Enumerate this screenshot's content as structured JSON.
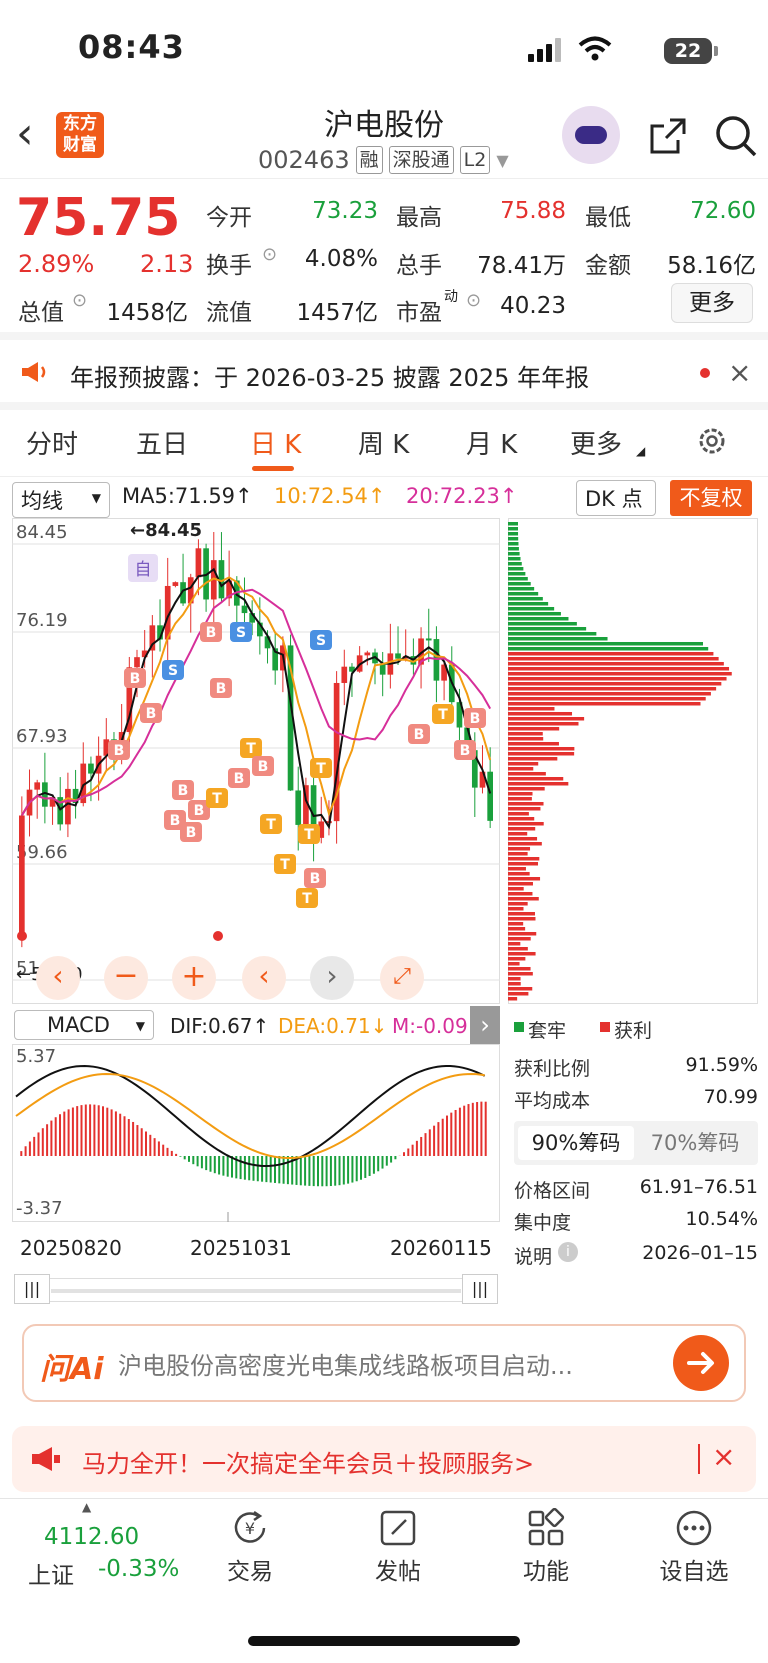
{
  "status": {
    "time": "08:43",
    "battery": "22"
  },
  "header": {
    "title": "沪电股份",
    "code": "002463",
    "tags": [
      "融",
      "深股通",
      "L2"
    ],
    "logo": "东方\n财富"
  },
  "quote": {
    "price": "75.75",
    "pct": "2.89%",
    "chg": "2.13",
    "rows": [
      [
        {
          "label": "今开",
          "value": "73.23",
          "color": "green"
        },
        {
          "label": "最高",
          "value": "75.88",
          "color": "red"
        },
        {
          "label": "最低",
          "value": "72.60",
          "color": "green"
        }
      ],
      [
        {
          "label": "换手",
          "value": "4.08%",
          "color": ""
        },
        {
          "label": "总手",
          "value": "78.41万",
          "color": ""
        },
        {
          "label": "金额",
          "value": "58.16亿",
          "color": ""
        }
      ],
      [
        {
          "label": "总值",
          "value": "1458亿",
          "color": ""
        },
        {
          "label": "流值",
          "value": "1457亿",
          "color": ""
        },
        {
          "label": "市盈",
          "value": "40.23",
          "color": ""
        }
      ]
    ],
    "pe_sup": "动",
    "more": "更多"
  },
  "notice": {
    "text": "年报预披露：于 2026-03-25 披露 2025 年年报"
  },
  "tabs": [
    "分时",
    "五日",
    "日 K",
    "周 K",
    "月 K",
    "更多"
  ],
  "ma": {
    "select": "均线",
    "ma5": "MA5:71.59↑",
    "ma10": "10:72.54↑",
    "ma20": "20:72.23↑",
    "dk": "DK 点",
    "fq": "不复权"
  },
  "kchart": {
    "y_ticks": [
      "84.45",
      "76.19",
      "67.93",
      "59.66",
      "51.40"
    ],
    "max_label": "←84.45",
    "min_label": "←51.40",
    "self_tag": "自"
  },
  "macd": {
    "select": "MACD",
    "dif": "DIF:0.67↑",
    "dea": "DEA:0.71↓",
    "m": "M:-0.09",
    "top": "5.37",
    "bottom": "-3.37",
    "dates": [
      "20250820",
      "20251031",
      "20260115"
    ]
  },
  "chip": {
    "legend_a": "套牢",
    "legend_b": "获利",
    "profit_ratio_label": "获利比例",
    "profit_ratio": "91.59%",
    "avg_cost_label": "平均成本",
    "avg_cost": "70.99",
    "tab90": "90%筹码",
    "tab70": "70%筹码",
    "range_label": "价格区间",
    "range": "61.91–76.51",
    "conc_label": "集中度",
    "conc": "10.54%",
    "note_label": "说明",
    "note": "2026–01–15"
  },
  "ai": {
    "logo": "问Ai",
    "text": "沪电股份高密度光电集成线路板项目启动..."
  },
  "promo": {
    "text": "马力全开！一次搞定全年会员＋投顾服务>"
  },
  "nav": {
    "index_value": "4112.60",
    "index_name": "上证",
    "index_chg": "-0.33%",
    "items": [
      "交易",
      "发帖",
      "功能",
      "设自选"
    ]
  },
  "colors": {
    "accent": "#f05a1a",
    "up": "#e4312e",
    "down": "#1aa03c",
    "ma10": "#f39c12",
    "ma20": "#d62f9a"
  }
}
